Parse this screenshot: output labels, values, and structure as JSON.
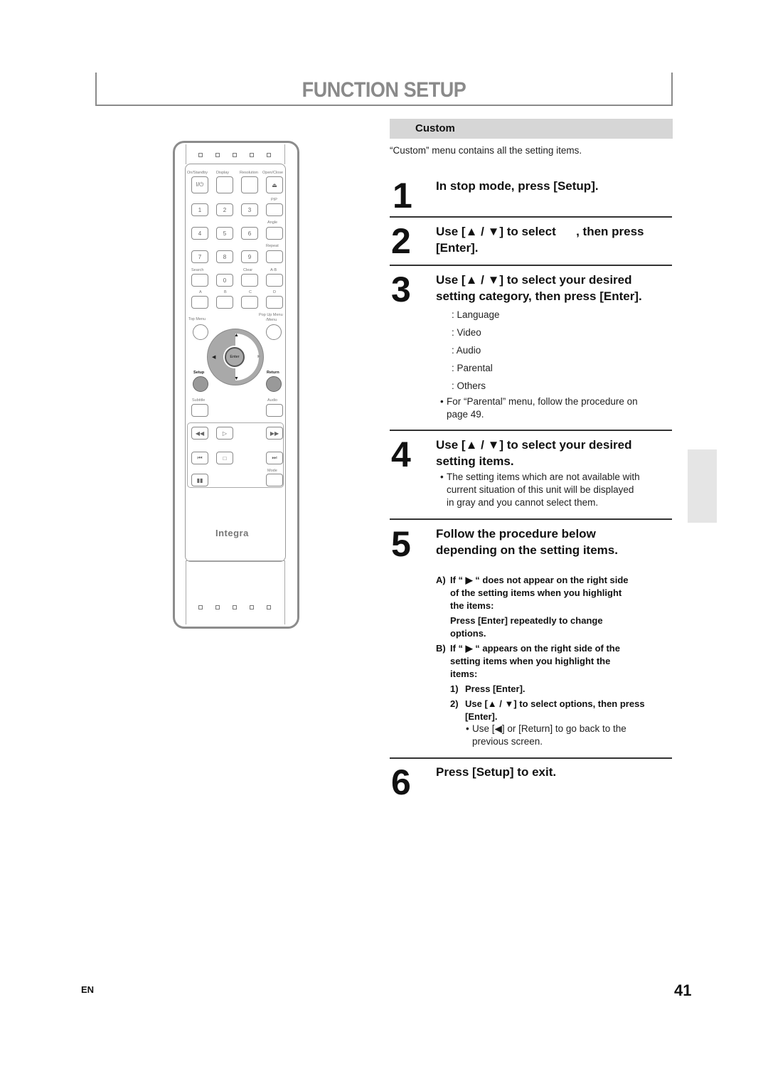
{
  "header": {
    "title": "FUNCTION SETUP"
  },
  "section": {
    "title": "Custom",
    "intro": "“Custom” menu contains all the setting items."
  },
  "steps": [
    {
      "num": "1",
      "title": "In stop mode, press [Setup]."
    },
    {
      "num": "2",
      "title_line1": "Use [▲ / ▼] to select      , then press",
      "title_line2": "[Enter]."
    },
    {
      "num": "3",
      "title_line1": "Use [▲ / ▼] to select your desired",
      "title_line2": "setting category, then press [Enter].",
      "categories": [
        ": Language",
        ": Video",
        ": Audio",
        ": Parental",
        ": Others"
      ],
      "note_line1": "For “Parental” menu, follow the procedure on",
      "note_line2": "page 49."
    },
    {
      "num": "4",
      "title_line1": "Use [▲ / ▼] to select your desired",
      "title_line2": "setting items.",
      "note_lines": [
        "The setting items which are not available with",
        "current situation of this unit will be displayed",
        "in gray and you cannot select them."
      ]
    },
    {
      "num": "5",
      "title_line1": "Follow the procedure below",
      "title_line2": "depending on the setting items.",
      "case_a": {
        "label": "A)",
        "lines": [
          "If “ ▶ “ does not appear on the right side",
          "of the setting items when you highlight",
          "the items:"
        ],
        "action_lines": [
          "Press [Enter] repeatedly to change",
          "options."
        ]
      },
      "case_b": {
        "label": "B)",
        "lines": [
          "If “ ▶ “ appears on the right side of the",
          "setting items when you highlight the",
          "items:"
        ],
        "substeps": [
          {
            "label": "1)",
            "text": "Press [Enter]."
          },
          {
            "label": "2)",
            "text_line1": "Use [▲ / ▼] to select options, then press",
            "text_line2": "[Enter]."
          }
        ],
        "note_line1": "Use [◀] or [Return] to go back to the",
        "note_line2": "previous screen."
      }
    },
    {
      "num": "6",
      "title": "Press [Setup] to exit."
    }
  ],
  "remote": {
    "brand": "Integra",
    "labels": {
      "on_standby": "On/Standby",
      "display": "Display",
      "resolution": "Resolution",
      "open_close": "Open/Close",
      "pip": "PIP",
      "angle": "Angle",
      "repeat": "Repeat",
      "search": "Search",
      "clear": "Clear",
      "ab": "A-B",
      "a": "A",
      "b": "B",
      "c": "C",
      "d": "D",
      "top_menu": "Top Menu",
      "popup_line1": "Pop Up Menu",
      "popup_line2": "/Menu",
      "setup": "Setup",
      "return": "Return",
      "subtitle": "Subtitle",
      "audio": "Audio",
      "mode": "Mode",
      "enter": "Enter"
    },
    "numbers": [
      "1",
      "2",
      "3",
      "4",
      "5",
      "6",
      "7",
      "8",
      "9",
      "0"
    ],
    "power_glyph": "I/⏻",
    "eject_glyph": "⏏"
  },
  "footer": {
    "lang": "EN",
    "page": "41"
  }
}
